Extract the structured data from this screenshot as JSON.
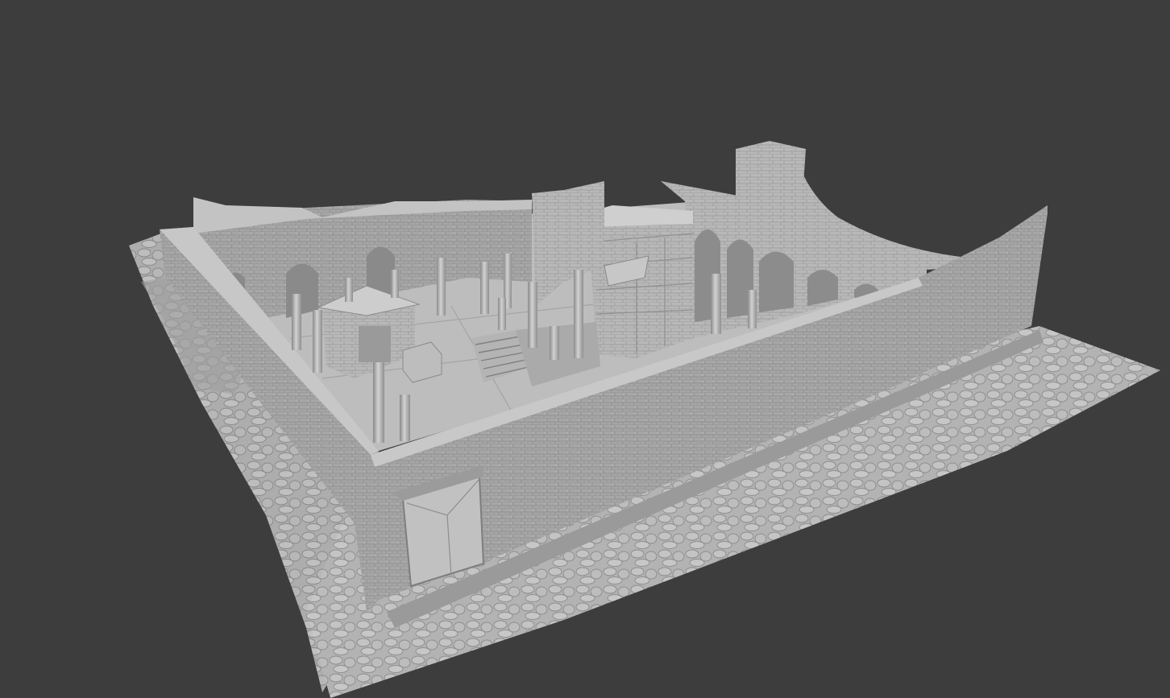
{
  "viewport": {
    "background": "#3d3d3d",
    "model": "roman-ruin-photogrammetry-mesh",
    "shading": "solid-gray-matcap",
    "palette": {
      "mesh_light": "#c9c9c9",
      "mesh_mid": "#a9a9a9",
      "mesh_dark": "#7e7e7e",
      "mesh_shadow": "#6a6a6a",
      "floor": "#bcbcbc",
      "paving": "#b0b0b0"
    }
  }
}
